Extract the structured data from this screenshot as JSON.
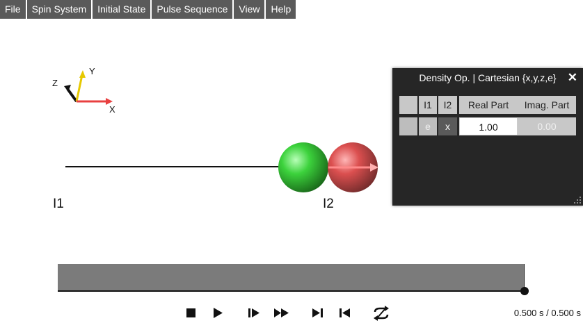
{
  "menu": {
    "items": [
      {
        "label": "File"
      },
      {
        "label": "Spin System"
      },
      {
        "label": "Initial State"
      },
      {
        "label": "Pulse Sequence"
      },
      {
        "label": "View"
      },
      {
        "label": "Help"
      }
    ]
  },
  "axes": {
    "x": "X",
    "y": "Y",
    "z": "Z"
  },
  "spins": {
    "i1_label": "I1",
    "i2_label": "I2"
  },
  "density_panel": {
    "title": "Density Op. | Cartesian {x,y,z,e}",
    "close_symbol": "✕",
    "columns": {
      "i1": "I1",
      "i2": "I2",
      "real": "Real Part",
      "imag": "Imag. Part"
    },
    "rows": [
      {
        "i1": "e",
        "i2": "x",
        "real": "1.00",
        "imag": "0.00"
      }
    ]
  },
  "timeline": {
    "progress_fraction": 1.0,
    "time_readout": "0.500 s / 0.500 s"
  },
  "controls": {
    "stop": "stop-icon",
    "play": "play-icon",
    "step_forward": "step-forward-icon",
    "fast_forward": "fast-forward-icon",
    "skip_to_end": "skip-to-end-icon",
    "skip_to_start": "skip-to-start-icon",
    "loop": "loop-icon"
  },
  "colors": {
    "menu_bg": "#5a5a5a",
    "panel_bg": "#262626",
    "spin1": "#3cc83c",
    "spin2": "#d23a3a",
    "timeline_bg": "#7b7b7b"
  }
}
